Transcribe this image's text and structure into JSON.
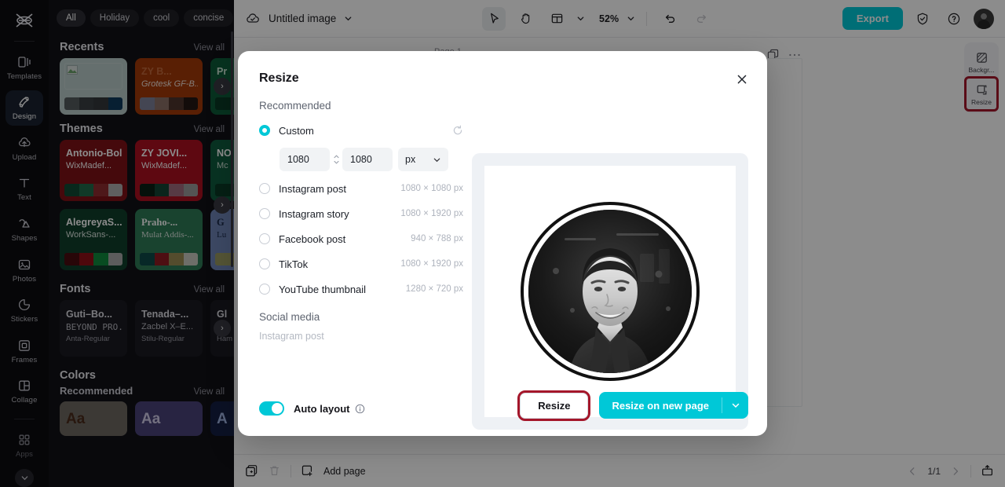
{
  "app": {
    "name": "CapCut",
    "logo_icon": "capcut-logo-icon"
  },
  "left_rail": {
    "items": [
      {
        "label": "Templates",
        "icon": "templates-icon",
        "active": false
      },
      {
        "label": "Design",
        "icon": "design-icon",
        "active": true
      },
      {
        "label": "Upload",
        "icon": "upload-cloud-icon",
        "active": false
      },
      {
        "label": "Text",
        "icon": "text-icon",
        "active": false
      },
      {
        "label": "Shapes",
        "icon": "shapes-icon",
        "active": false
      },
      {
        "label": "Photos",
        "icon": "photos-icon",
        "active": false
      },
      {
        "label": "Stickers",
        "icon": "stickers-icon",
        "active": false
      },
      {
        "label": "Frames",
        "icon": "frames-icon",
        "active": false
      },
      {
        "label": "Collage",
        "icon": "collage-icon",
        "active": false
      },
      {
        "label": "Apps",
        "icon": "apps-grid-icon",
        "active": false
      }
    ],
    "expand_icon": "chevron-down-icon"
  },
  "side_panel": {
    "chips": [
      {
        "label": "All",
        "active": true
      },
      {
        "label": "Holiday",
        "active": false
      },
      {
        "label": "cool",
        "active": false
      },
      {
        "label": "concise",
        "active": false
      }
    ],
    "chips_more_icon": "chevron-down-icon",
    "view_all": "View all",
    "sections": {
      "recents": {
        "title": "Recents",
        "cards": [
          {
            "bg": "#b9cbc9",
            "t1": "",
            "t2": "",
            "swatches": [
              "#555b5e",
              "#3a3f42",
              "#33383b",
              "#0e3a5c"
            ],
            "has_image": true
          },
          {
            "bg": "#a33a08",
            "t1": "ZY B...",
            "t2": "Grotesk GF-B...",
            "t1_color": "#c4693b",
            "t2_color": "#f0e3dc",
            "swatches": [
              "#7d8098",
              "#8a6f67",
              "#4e332c",
              "#241613"
            ]
          },
          {
            "bg": "#0e5c3a",
            "t1": "Pr",
            "t2": "",
            "t1_color": "#cfe8d8",
            "t2_color": "#cfe8d8",
            "swatches": [
              "#0a3a26",
              "#0a3a26",
              "#0a3a26",
              "#0a3a26"
            ]
          }
        ]
      },
      "themes": {
        "title": "Themes",
        "row1": [
          {
            "bg": "#7e1216",
            "t1": "Antonio-Bold",
            "t2": "WixMadef...",
            "t1_color": "#ffffff",
            "t2_color": "#ffffff",
            "swatches": [
              "#0f4a33",
              "#1f6a4a",
              "#8e2d30",
              "#adadad"
            ]
          },
          {
            "bg": "#ab1020",
            "t1": "ZY JOVI...",
            "t2": "WixMadef...",
            "t1_color": "#ffffff",
            "t2_color": "#ffffff",
            "swatches": [
              "#0a2015",
              "#134434",
              "#9f6a7d",
              "#9a9a9a"
            ]
          },
          {
            "bg": "#0f5c3e",
            "t1": "NO",
            "t2": "Mc",
            "t1_color": "#ffffff",
            "t2_color": "#cfe0d6",
            "swatches": [
              "#0a3a26",
              "#0a3a26",
              "#0a3a26",
              "#0a3a26"
            ]
          }
        ],
        "row2": [
          {
            "bg": "#0f3e2a",
            "t1": "AlegreyaS...",
            "t2": "WorkSans-...",
            "t1_color": "#ffffff",
            "t2_color": "#dfe7e2",
            "swatches": [
              "#4a0c10",
              "#8e1016",
              "#0f8a3c",
              "#a8a8a8"
            ]
          },
          {
            "bg": "#2e7a56",
            "t1": "Praho-...",
            "t2": "Mulat Addis-...",
            "t1_color": "#ffffff",
            "t2_color": "#dfe7e2",
            "swatches": [
              "#0e4a48",
              "#8e1a22",
              "#9a8a52",
              "#c8c8c0"
            ]
          },
          {
            "bg": "#6d84b4",
            "t1": "G",
            "t2": "Lu",
            "t1_color": "#1a2a4a",
            "t2_color": "#1a2a4a",
            "swatches": [
              "#9a9a62",
              "#9a9a62",
              "#9a9a62",
              "#9a9a62"
            ]
          }
        ]
      },
      "fonts": {
        "title": "Fonts",
        "cards": [
          {
            "f1": "Guti–Bo...",
            "f2": "BEYOND PRO...",
            "f3": "Anta-Regular"
          },
          {
            "f1": "Tenada–...",
            "f2": "Zacbel X–E...",
            "f3": "Stilu-Regular"
          },
          {
            "f1": "Gl",
            "f2": "(",
            "f3": "Ham"
          }
        ]
      },
      "colors": {
        "title": "Colors",
        "sub_title": "Recommended",
        "cards": [
          {
            "bg": "#6d6861",
            "text": "Aa",
            "color": "#4a2a1a"
          },
          {
            "bg": "#4a4378",
            "text": "Aa",
            "color": "#cfcbe8"
          },
          {
            "bg": "#141f44",
            "text": "A",
            "color": "#9fb2e0"
          }
        ]
      }
    },
    "next_arrow_icon": "chevron-right-icon"
  },
  "topbar": {
    "cloud_icon": "cloud-check-icon",
    "doc_title": "Untitled image",
    "title_chevron_icon": "chevron-down-icon",
    "tools": [
      {
        "icon": "cursor-select-icon",
        "selected": true
      },
      {
        "icon": "hand-pan-icon",
        "selected": false
      },
      {
        "icon": "layout-grid-icon",
        "selected": false
      }
    ],
    "layout_chevron_icon": "chevron-down-icon",
    "zoom_level": "52%",
    "zoom_chevron_icon": "chevron-down-icon",
    "undo_icon": "undo-icon",
    "redo_icon": "redo-icon",
    "export_label": "Export",
    "shield_icon": "shield-check-icon",
    "help_icon": "help-circle-icon",
    "avatar_icon": "user-avatar"
  },
  "canvas": {
    "page_label": "Page 1",
    "duplicate_icon": "duplicate-page-icon",
    "more_icon": "more-horizontal-icon"
  },
  "right_panel": {
    "items": [
      {
        "label": "Backgr...",
        "icon": "background-icon",
        "highlighted": false
      },
      {
        "label": "Resize",
        "icon": "resize-icon",
        "highlighted": true
      }
    ],
    "highlight_color": "#a4162a"
  },
  "bottombar": {
    "duplicate_icon": "duplicate-icon",
    "delete_icon": "trash-icon",
    "add_page_icon": "add-page-icon",
    "add_page_label": "Add page",
    "prev_icon": "chevron-left-icon",
    "page_indicator": "1/1",
    "next_icon": "chevron-right-icon",
    "present_icon": "present-icon"
  },
  "modal": {
    "title": "Resize",
    "close_icon": "close-icon",
    "recommended_label": "Recommended",
    "custom": {
      "label": "Custom",
      "selected": true,
      "reset_icon": "reset-icon",
      "width": "1080",
      "height": "1080",
      "link_icon": "link-dimensions-icon",
      "unit": "px",
      "unit_chevron_icon": "chevron-down-icon"
    },
    "presets": [
      {
        "label": "Instagram post",
        "dims": "1080 × 1080 px",
        "selected": false
      },
      {
        "label": "Instagram story",
        "dims": "1080 × 1920 px",
        "selected": false
      },
      {
        "label": "Facebook post",
        "dims": "940 × 788 px",
        "selected": false
      },
      {
        "label": "TikTok",
        "dims": "1080 × 1920 px",
        "selected": false
      },
      {
        "label": "YouTube thumbnail",
        "dims": "1280 × 720 px",
        "selected": false
      }
    ],
    "social_media": {
      "title": "Social media",
      "items": [
        "Instagram post"
      ]
    },
    "auto_layout": {
      "label": "Auto layout",
      "enabled": true,
      "info_icon": "info-circle-icon"
    },
    "buttons": {
      "resize_label": "Resize",
      "resize_highlighted": true,
      "primary_label": "Resize on new page",
      "primary_chevron_icon": "chevron-down-icon",
      "accent_color": "#00c8d7"
    },
    "preview": {
      "description": "black-and-white circular portrait photo of a smiling man"
    }
  }
}
